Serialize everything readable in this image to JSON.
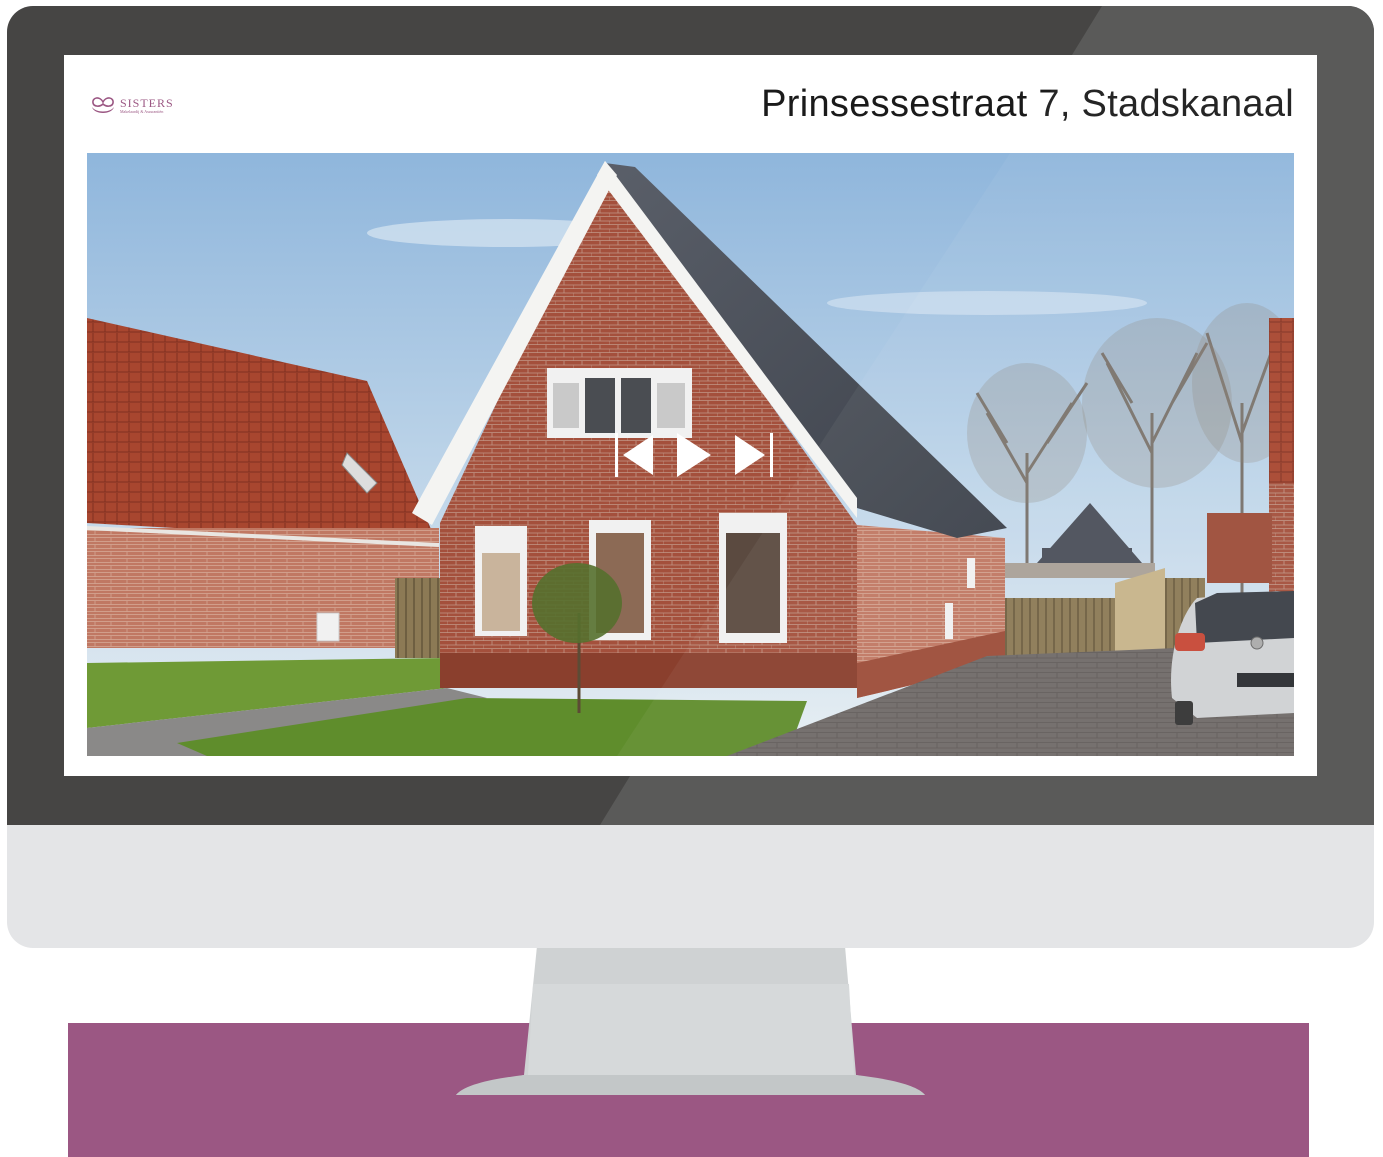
{
  "brand": {
    "name": "SISTERS",
    "tagline": "Makelaardij & Assurantiën",
    "color": "#9b5783"
  },
  "listing": {
    "address": "Prinsessestraat 7, Stadskanaal"
  },
  "slideshow": {
    "controls": [
      {
        "name": "previous",
        "icon": "skip-previous-icon"
      },
      {
        "name": "play",
        "icon": "play-icon"
      },
      {
        "name": "next",
        "icon": "skip-next-icon"
      }
    ]
  },
  "colors": {
    "bezel": "#464544",
    "chin": "#e4e5e7",
    "stand": "#cfd2d3",
    "floor": "#9b5783"
  }
}
